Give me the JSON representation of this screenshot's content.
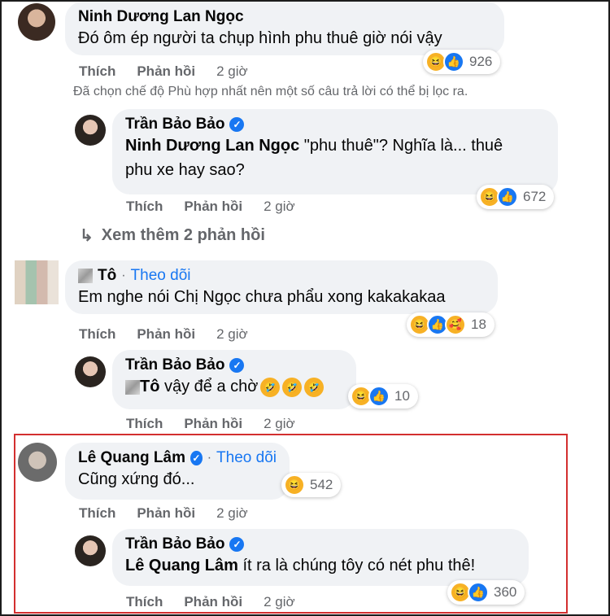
{
  "comments": [
    {
      "name": "Ninh Dương Lan Ngọc",
      "text": "Đó ôm ép người ta chụp hình phu thuê giờ nói vậy",
      "like": "Thích",
      "reply": "Phản hồi",
      "time": "2 giờ",
      "reaction_count": "926"
    }
  ],
  "filter_notice": "Đã chọn chế độ Phù hợp nhất nên một số câu trả lời có thể bị lọc ra.",
  "reply1": {
    "name": "Trần Bảo Bảo",
    "mention": "Ninh Dương Lan Ngọc",
    "text_line1": " \"phu thuê\"? Nghĩa là... thuê",
    "text_line2": "phu xe hay sao?",
    "like": "Thích",
    "reply": "Phản hồi",
    "time": "2 giờ",
    "reaction_count": "672"
  },
  "see_more": "Xem thêm 2 phản hồi",
  "comment2": {
    "name": "Tô",
    "separator": "·",
    "follow": "Theo dõi",
    "text": "Em nghe nói Chị Ngọc chưa phẩu xong kakakakaa",
    "like": "Thích",
    "reply": "Phản hồi",
    "time": "2 giờ",
    "reaction_count": "18"
  },
  "reply2": {
    "name": "Trần Bảo Bảo",
    "mention": "Tô",
    "text": " vậy để a chờ",
    "like": "Thích",
    "reply": "Phản hồi",
    "time": "2 giờ",
    "reaction_count": "10"
  },
  "comment3": {
    "name": "Lê Quang Lâm",
    "separator": "·",
    "follow": "Theo dõi",
    "text": "Cũng xứng đó...",
    "like": "Thích",
    "reply": "Phản hồi",
    "time": "2 giờ",
    "reaction_count": "542"
  },
  "reply3": {
    "name": "Trần Bảo Bảo",
    "mention": "Lê Quang Lâm",
    "text": " ít ra là chúng tôy có nét phu thê!",
    "like": "Thích",
    "reply": "Phản hồi",
    "time": "2 giờ",
    "reaction_count": "360"
  },
  "colors": {
    "accent": "#1877f2",
    "muted": "#65676b",
    "bubble": "#f0f2f5",
    "highlight": "#d32f2f"
  }
}
